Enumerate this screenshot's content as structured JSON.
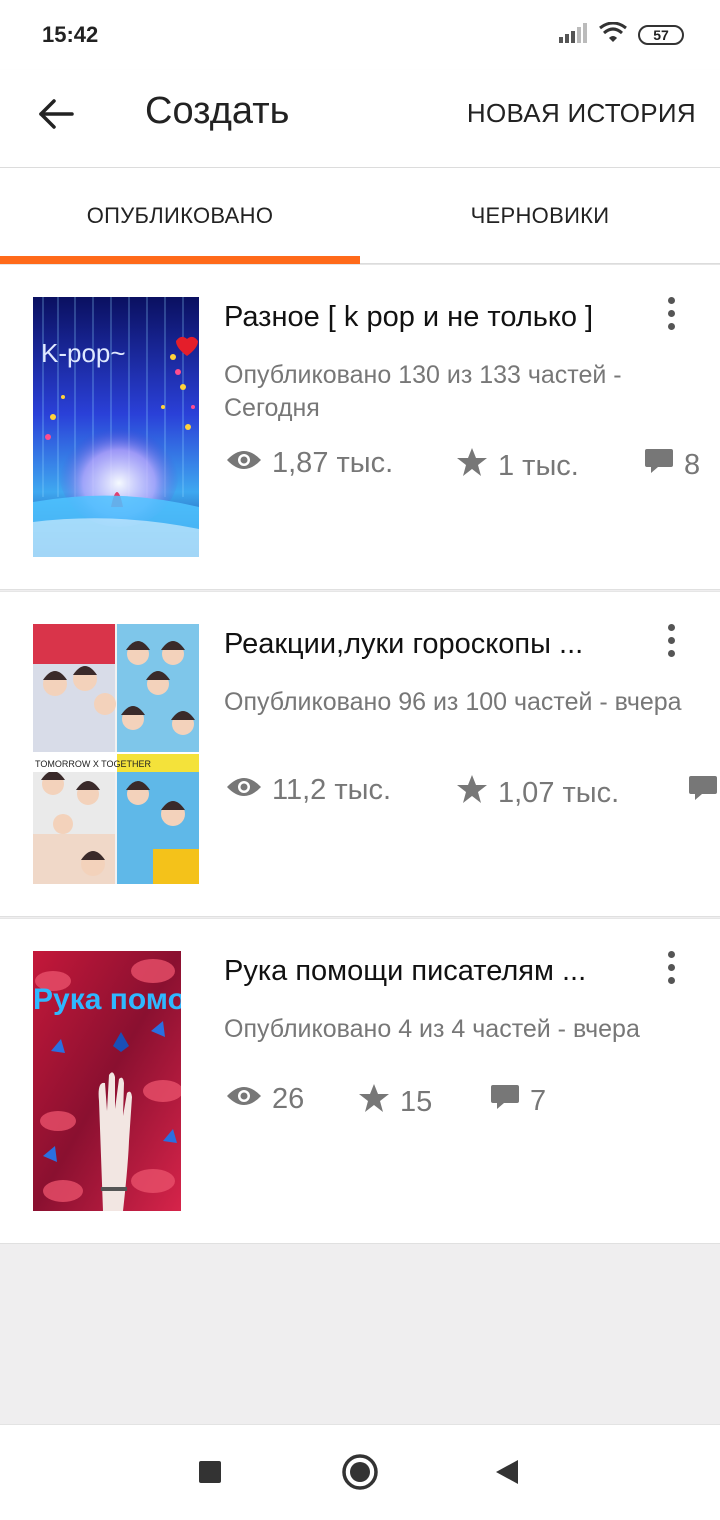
{
  "status_bar": {
    "time": "15:42",
    "battery": "57",
    "icons": [
      "signal-icon",
      "wifi-icon",
      "battery-icon"
    ]
  },
  "app_bar": {
    "back_icon": "arrow-back-icon",
    "title": "Создать",
    "action": "НОВАЯ ИСТОРИЯ"
  },
  "tabs": [
    {
      "label": "ОПУБЛИКОВАНО",
      "active": true
    },
    {
      "label": "ЧЕРНОВИКИ",
      "active": false
    }
  ],
  "accent_color": "#ff6a1a",
  "stories": [
    {
      "title": "Разное [ k pop и не только ]",
      "subtitle": "Опубликовано 130 из 133 частей - Сегодня",
      "cover_text": "K-pop~",
      "views": "1,87 тыс.",
      "stars": "1 тыс.",
      "comments": "8"
    },
    {
      "title": "Реакции,луки гороскопы ...",
      "subtitle": "Опубликовано 96 из 100 частей - вчера",
      "cover_text": "TOMORROW X TOGETHER",
      "views": "11,2 тыс.",
      "stars": "1,07 тыс.",
      "comments": ""
    },
    {
      "title": "Рука помощи писателям ...",
      "subtitle": "Опубликовано 4 из 4 частей - вчера",
      "cover_text": "Рука помощи",
      "views": "26",
      "stars": "15",
      "comments": "7"
    }
  ],
  "nav_bar": {
    "icons": [
      "recent-apps-icon",
      "home-icon",
      "back-triangle-icon"
    ]
  }
}
